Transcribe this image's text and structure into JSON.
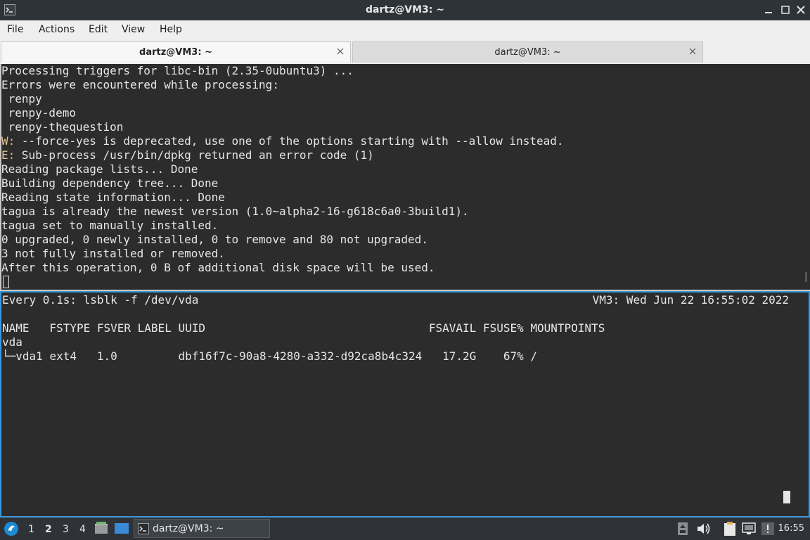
{
  "window": {
    "title": "dartz@VM3: ~"
  },
  "menu": [
    "File",
    "Actions",
    "Edit",
    "View",
    "Help"
  ],
  "tabs": [
    {
      "label": "dartz@VM3: ~",
      "active": true
    },
    {
      "label": "dartz@VM3: ~",
      "active": false
    }
  ],
  "pane1": {
    "lines": [
      {
        "text": "Processing triggers for libc-bin (2.35-0ubuntu3) ..."
      },
      {
        "text": "Errors were encountered while processing:"
      },
      {
        "text": " renpy"
      },
      {
        "text": " renpy-demo"
      },
      {
        "text": " renpy-thequestion"
      },
      {
        "prefix": "W:",
        "text": " --force-yes is deprecated, use one of the options starting with --allow instead."
      },
      {
        "prefix": "E:",
        "text": " Sub-process /usr/bin/dpkg returned an error code (1)"
      },
      {
        "text": "Reading package lists... Done"
      },
      {
        "text": "Building dependency tree... Done"
      },
      {
        "text": "Reading state information... Done"
      },
      {
        "text": "tagua is already the newest version (1.0~alpha2-16-g618c6a0-3build1)."
      },
      {
        "text": "tagua set to manually installed."
      },
      {
        "text": "0 upgraded, 0 newly installed, 0 to remove and 80 not upgraded."
      },
      {
        "text": "3 not fully installed or removed."
      },
      {
        "text": "After this operation, 0 B of additional disk space will be used."
      }
    ]
  },
  "pane2": {
    "header_left": "Every 0.1s: lsblk -f /dev/vda",
    "header_right": "VM3: Wed Jun 22 16:55:02 2022",
    "table_lines": [
      "NAME   FSTYPE FSVER LABEL UUID                                 FSAVAIL FSUSE% MOUNTPOINTS",
      "vda",
      "└─vda1 ext4   1.0         dbf16f7c-90a8-4280-a332-d92ca8b4c324   17.2G    67% /"
    ]
  },
  "taskbar": {
    "workspaces": [
      "1",
      "2",
      "3",
      "4"
    ],
    "active_workspace": "2",
    "task_label": "dartz@VM3: ~",
    "clock": "16:55"
  },
  "colors": {
    "accent": "#3a9ad9",
    "prefix": "#e2c28b",
    "terminal_bg": "#2c2c2c"
  }
}
